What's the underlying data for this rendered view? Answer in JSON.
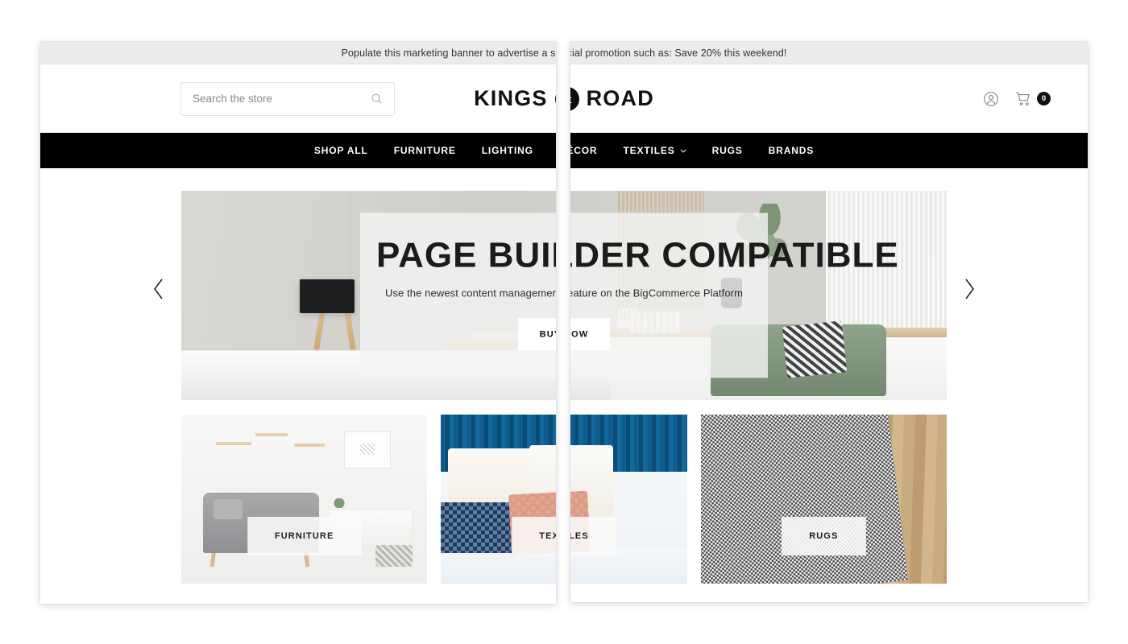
{
  "promo": {
    "text": "Populate this marketing banner to advertise a special promotion such as: Save 20% this weekend!"
  },
  "search": {
    "placeholder": "Search the store",
    "value": "",
    "icon": "search-icon"
  },
  "brand": {
    "word1": "KINGS",
    "mark": "&",
    "word2": "ROAD"
  },
  "header_actions": {
    "account_icon": "account-icon",
    "cart_icon": "cart-icon",
    "cart_count": "0"
  },
  "nav": {
    "items": [
      {
        "label": "SHOP ALL",
        "has_dropdown": false
      },
      {
        "label": "FURNITURE",
        "has_dropdown": false
      },
      {
        "label": "LIGHTING",
        "has_dropdown": false
      },
      {
        "label": "DÉCOR",
        "has_dropdown": false
      },
      {
        "label": "TEXTILES",
        "has_dropdown": true
      },
      {
        "label": "RUGS",
        "has_dropdown": false
      },
      {
        "label": "BRANDS",
        "has_dropdown": false
      }
    ]
  },
  "hero": {
    "title": "PAGE BUILDER COMPATIBLE",
    "subtitle": "Use the newest content management feature on the BigCommerce Platform",
    "button": "BUY NOW",
    "prev_icon": "chevron-left-icon",
    "next_icon": "chevron-right-icon"
  },
  "tiles": [
    {
      "label": "FURNITURE"
    },
    {
      "label": "TEXTILES"
    },
    {
      "label": "RUGS"
    }
  ],
  "colors": {
    "nav_background": "#000000",
    "promo_background": "#ebebeb",
    "accent": "#111111",
    "page_background": "#ffffff"
  }
}
